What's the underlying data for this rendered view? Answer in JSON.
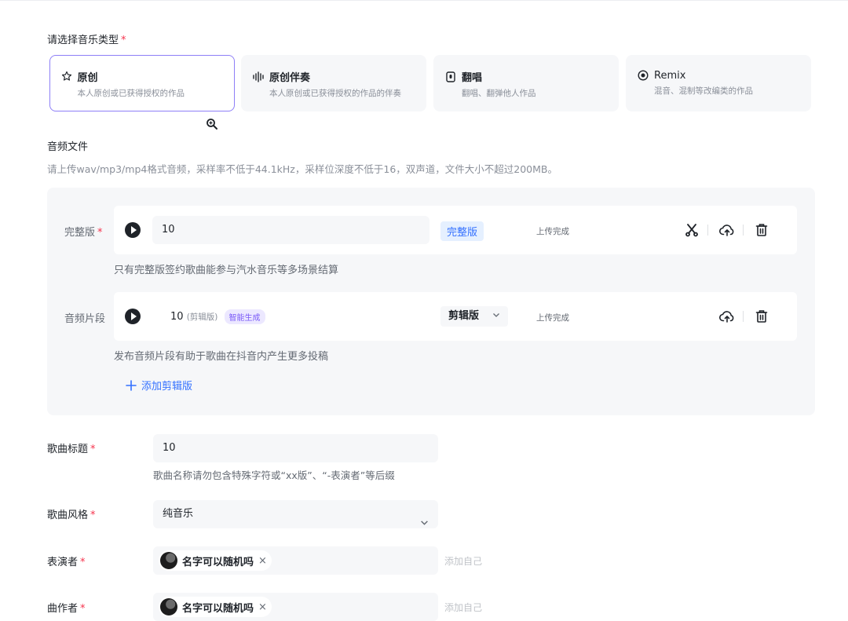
{
  "music_type": {
    "label": "请选择音乐类型",
    "required": "*",
    "options": [
      {
        "title": "原创",
        "desc": "本人原创或已获得授权的作品",
        "icon": "star-outline-icon"
      },
      {
        "title": "原创伴奏",
        "desc": "本人原创或已获得授权的作品的伴奏",
        "icon": "waveform-icon"
      },
      {
        "title": "翻唱",
        "desc": "翻唱、翻弹他人作品",
        "icon": "mic-icon"
      },
      {
        "title": "Remix",
        "desc": "混音、混制等改编类的作品",
        "icon": "disc-icon"
      }
    ],
    "selected": "原创"
  },
  "audio": {
    "label": "音频文件",
    "hint": "请上传wav/mp3/mp4格式音频，采样率不低于44.1kHz，采样位深度不低于16，双声道，文件大小不超过200MB。",
    "full": {
      "label": "完整版",
      "required": "*",
      "name": "10",
      "tag": "完整版",
      "status": "上传完成",
      "note": "只有完整版签约歌曲能参与汽水音乐等多场景结算"
    },
    "clip": {
      "label": "音频片段",
      "name": "10",
      "suffix": "(剪辑版)",
      "ai_tag": "智能生成",
      "version": "剪辑版",
      "status": "上传完成",
      "note": "发布音频片段有助于歌曲在抖音内产生更多投稿"
    },
    "add_clip": "添加剪辑版"
  },
  "form": {
    "title": {
      "label": "歌曲标题",
      "required": "*",
      "value": "10",
      "hint": "歌曲名称请勿包含特殊字符或“xx版”、“-表演者”等后缀"
    },
    "style": {
      "label": "歌曲风格",
      "required": "*",
      "value": "纯音乐"
    },
    "performer": {
      "label": "表演者",
      "required": "*",
      "name": "名字可以随机吗",
      "add_self": "添加自己"
    },
    "composer": {
      "label": "曲作者",
      "required": "*",
      "name": "名字可以随机吗",
      "add_self": "添加自己"
    }
  },
  "colors": {
    "accent": "#8e7ff7",
    "link": "#3370ff",
    "required": "#f5334d"
  }
}
